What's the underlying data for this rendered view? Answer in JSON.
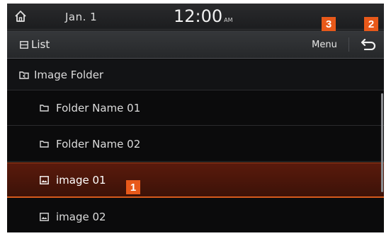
{
  "status_bar": {
    "date": "Jan.  1",
    "time": "12:00",
    "ampm": "AM"
  },
  "title_bar": {
    "title": "List",
    "menu_label": "Menu"
  },
  "list": {
    "header": {
      "label": "Image Folder",
      "icon": "folder-back-icon"
    },
    "items": [
      {
        "label": "Folder Name 01",
        "icon": "folder-icon",
        "selected": false
      },
      {
        "label": "Folder Name 02",
        "icon": "folder-icon",
        "selected": false
      },
      {
        "label": "image 01",
        "icon": "image-file-icon",
        "selected": true
      },
      {
        "label": "image 02",
        "icon": "image-file-icon",
        "selected": false
      }
    ]
  },
  "callouts": {
    "badge_1": "1",
    "badge_2": "2",
    "badge_3": "3"
  },
  "colors": {
    "accent": "#e8591a",
    "selection": "#5a1a0c"
  }
}
